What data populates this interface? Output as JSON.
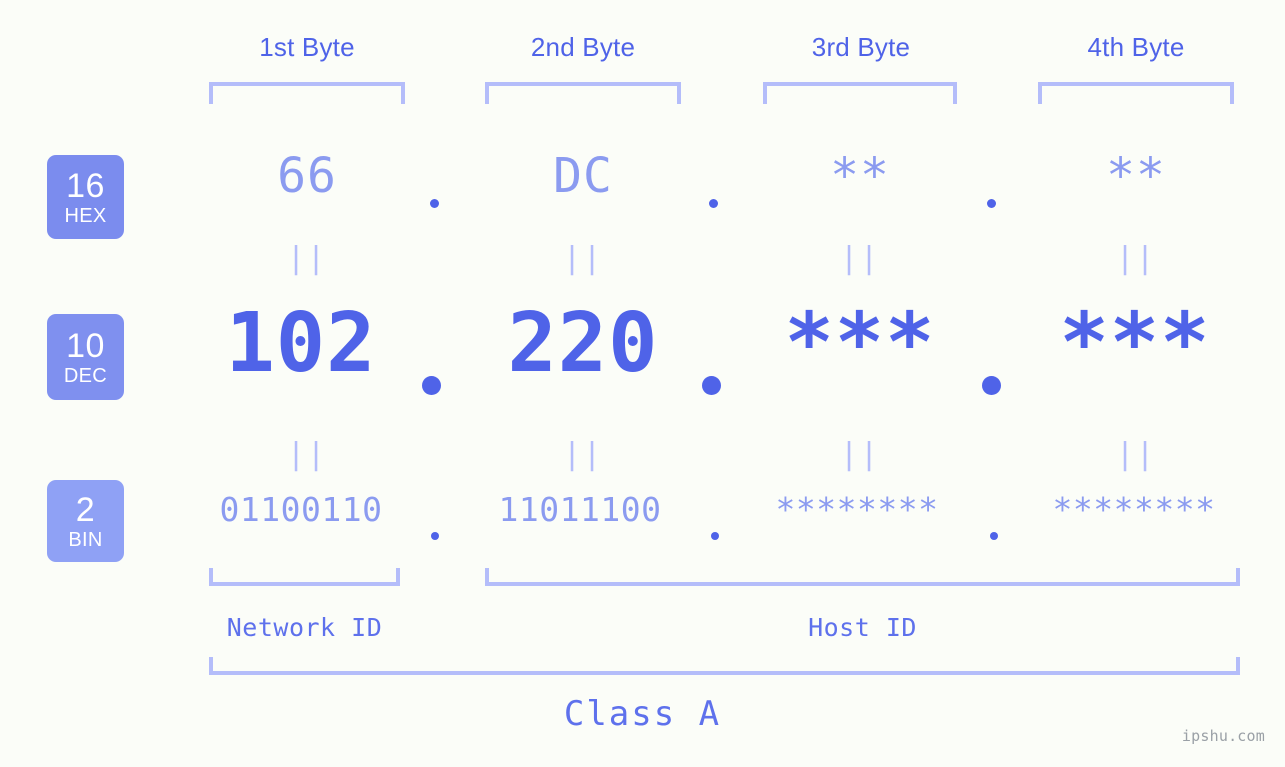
{
  "page": {
    "background_color": "#fbfdf8",
    "accent_color": "#4f63e8",
    "accent_light_color": "#8b9bf0",
    "bracket_color": "#b4bdfa",
    "watermark": "ipshu.com"
  },
  "byte_headers": [
    {
      "label": "1st Byte"
    },
    {
      "label": "2nd Byte"
    },
    {
      "label": "3rd Byte"
    },
    {
      "label": "4th Byte"
    }
  ],
  "bases": [
    {
      "number": "16",
      "name": "HEX",
      "color": "#7b8cee"
    },
    {
      "number": "10",
      "name": "DEC",
      "color": "#7f90ef"
    },
    {
      "number": "2",
      "name": "BIN",
      "color": "#8fa1f5"
    }
  ],
  "rows": {
    "hex": {
      "base_number": "16",
      "base_name": "HEX",
      "values": [
        "66",
        "DC",
        "**",
        "**"
      ],
      "separators": [
        ".",
        ".",
        "."
      ]
    },
    "dec": {
      "base_number": "10",
      "base_name": "DEC",
      "values": [
        "102",
        "220",
        "***",
        "***"
      ],
      "separators": [
        ".",
        ".",
        "."
      ]
    },
    "bin": {
      "base_number": "2",
      "base_name": "BIN",
      "values": [
        "01100110",
        "11011100",
        "********",
        "********"
      ],
      "separators": [
        ".",
        ".",
        "."
      ]
    }
  },
  "equals_marks": {
    "symbol": "||",
    "row1": [
      "||",
      "||",
      "||",
      "||"
    ],
    "row2": [
      "||",
      "||",
      "||",
      "||"
    ]
  },
  "segments": [
    {
      "label": "Network ID"
    },
    {
      "label": "Host ID"
    }
  ],
  "class": {
    "label": "Class A"
  }
}
